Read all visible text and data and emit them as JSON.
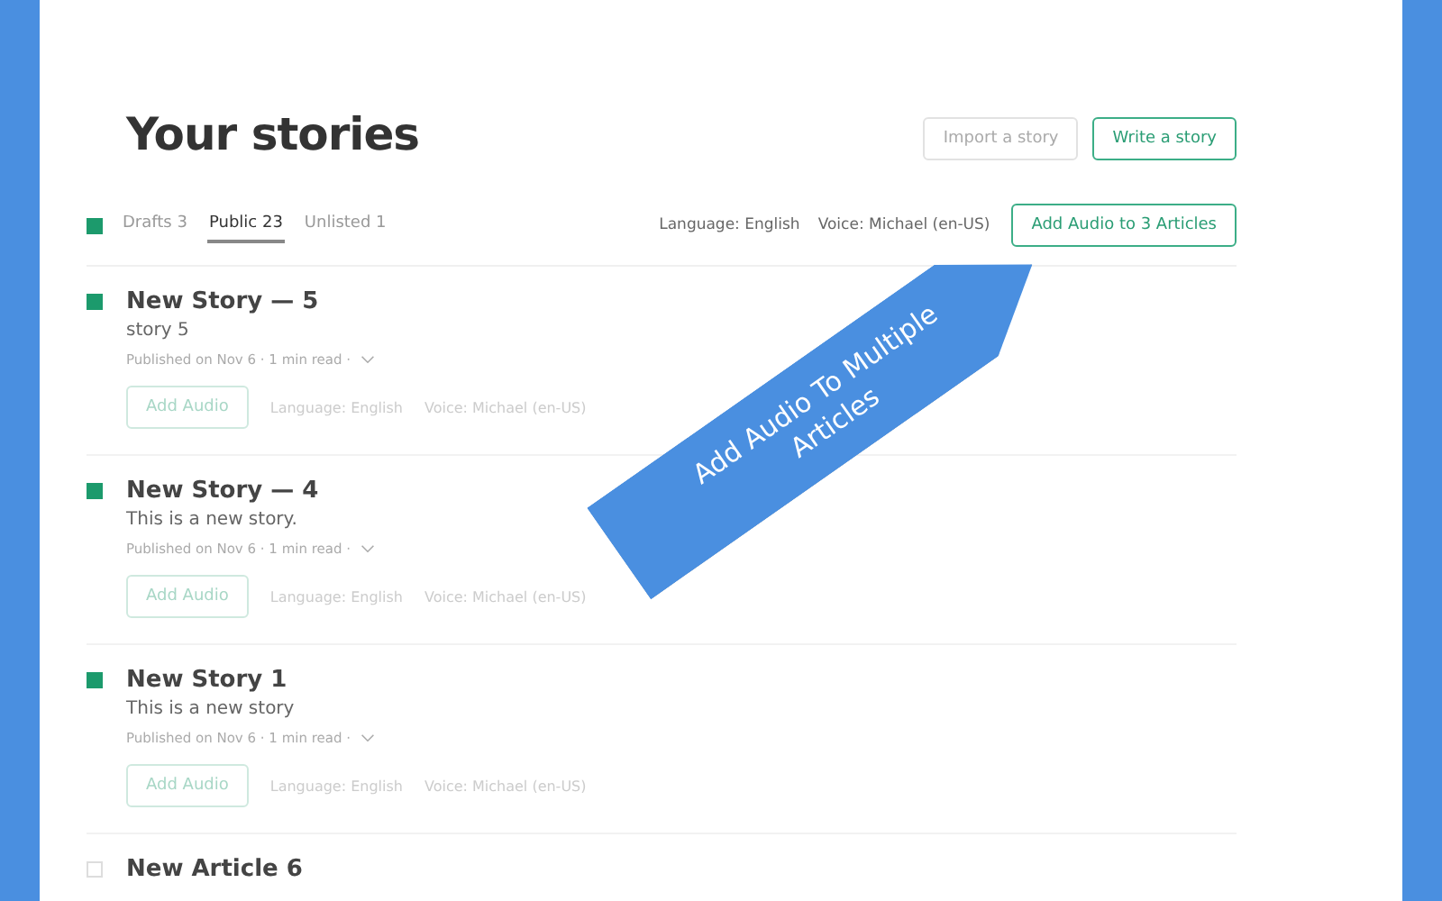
{
  "header": {
    "title": "Your stories",
    "buttons": [
      {
        "label": "Import a story",
        "kind": "plain"
      },
      {
        "label": "Write a story",
        "kind": "accent"
      }
    ]
  },
  "toolbar": {
    "select_all": {
      "checked": true
    },
    "tabs": [
      {
        "label": "Drafts",
        "count": "3",
        "selected": false
      },
      {
        "label": "Public",
        "count": "23",
        "selected": true
      },
      {
        "label": "Unlisted",
        "count": "1",
        "selected": false
      }
    ],
    "language": "Language: English",
    "voice": "Voice: Michael (en-US)",
    "bulk_button": "Add Audio to 3 Articles"
  },
  "stories": [
    {
      "title": "New Story — 5",
      "subtitle": "story 5",
      "meta": "Published on Nov 6 · 1 min read ·",
      "checked": true,
      "audio_button": "Add Audio",
      "language": "Language: English",
      "voice": "Voice: Michael (en-US)"
    },
    {
      "title": "New Story — 4",
      "subtitle": "This is a new story.",
      "meta": "Published on Nov 6 · 1 min read ·",
      "checked": true,
      "audio_button": "Add Audio",
      "language": "Language: English",
      "voice": "Voice: Michael (en-US)"
    },
    {
      "title": "New Story 1",
      "subtitle": "This is a new story",
      "meta": "Published on Nov 6 · 1 min read ·",
      "checked": true,
      "audio_button": "Add Audio",
      "language": "Language: English",
      "voice": "Voice: Michael (en-US)"
    },
    {
      "title": "New Article 6",
      "checked": false
    }
  ],
  "callout": "Add Audio To Multiple Articles"
}
